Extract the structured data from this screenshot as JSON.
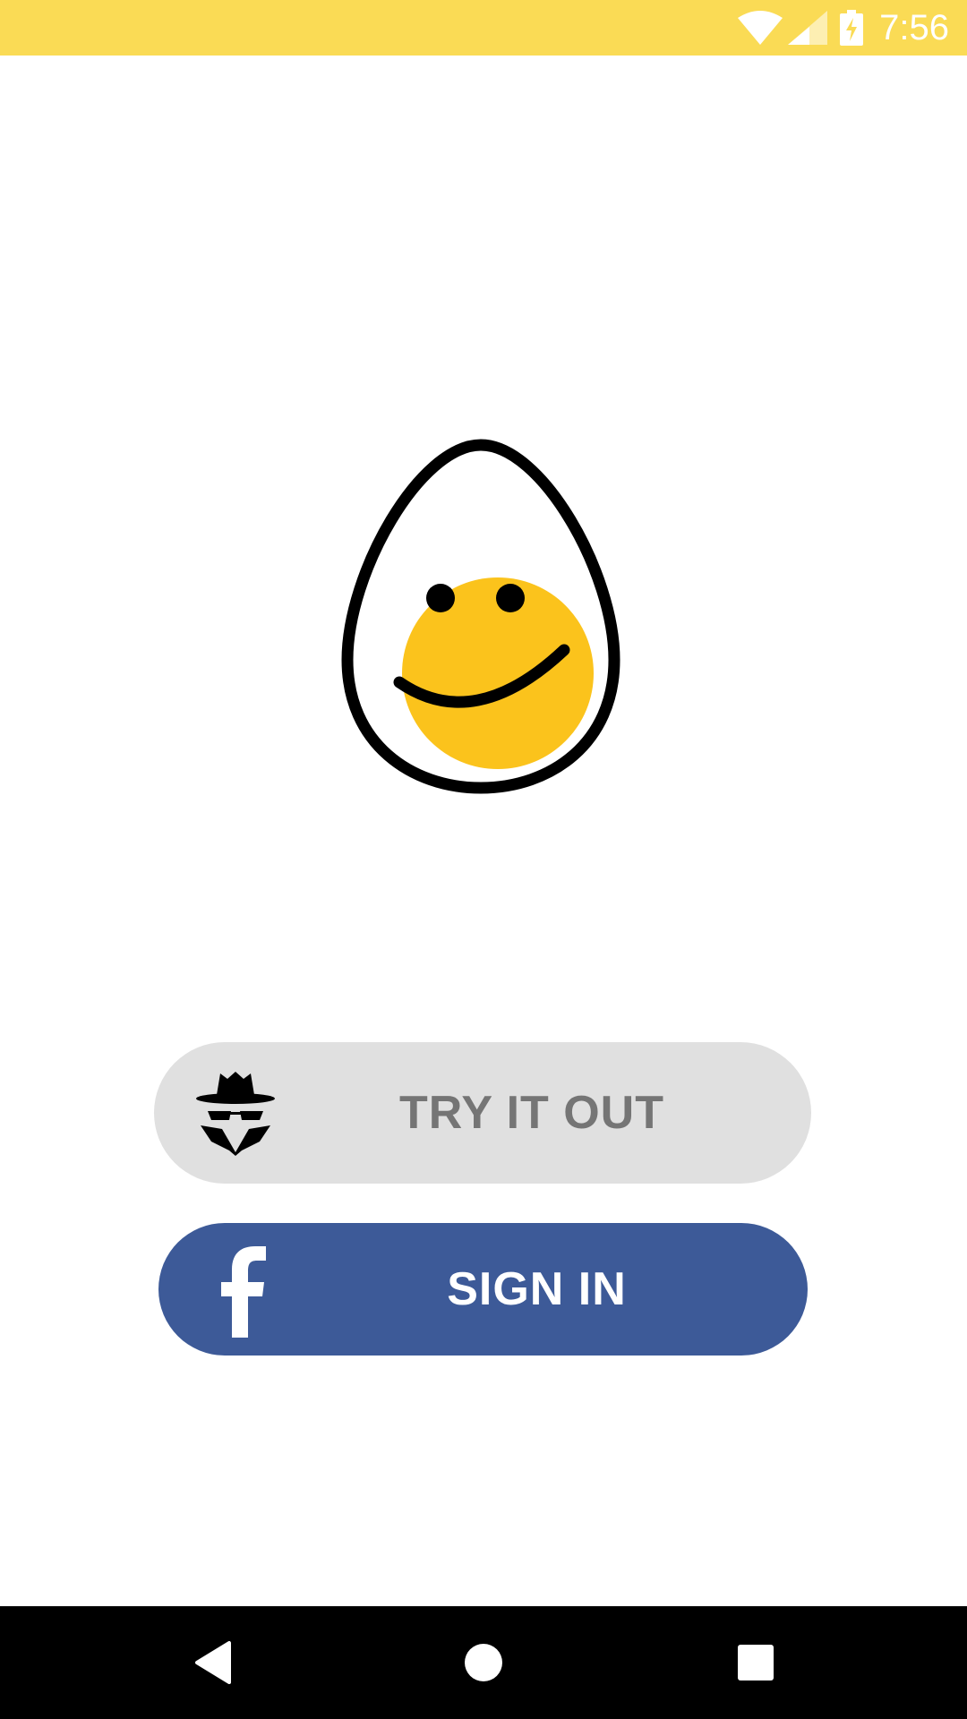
{
  "status_bar": {
    "time": "7:56",
    "icons": [
      "wifi-icon",
      "signal-icon",
      "battery-charging-icon"
    ],
    "background": "#FADB55"
  },
  "logo": {
    "icon": "egg-smiley-logo",
    "yolk_color": "#FBC31C"
  },
  "buttons": {
    "try_it_out": {
      "label": "TRY IT OUT",
      "icon": "incognito-spy-icon",
      "background": "#E0E0E0",
      "text_color": "#757575"
    },
    "sign_in": {
      "label": "SIGN IN",
      "icon": "facebook-icon",
      "background": "#3D5A98",
      "text_color": "#FFFFFF"
    }
  },
  "nav_bar": {
    "items": [
      "back-icon",
      "home-icon",
      "recents-icon"
    ],
    "background": "#000000"
  }
}
